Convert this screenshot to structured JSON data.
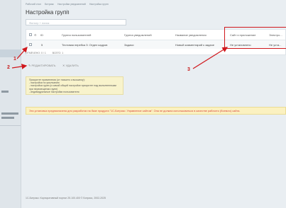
{
  "breadcrumbs": [
    "Рабочий стол",
    "Битрикс",
    "Настройки уведомлений",
    "Настройка групп"
  ],
  "page": {
    "title": "Настройка групп"
  },
  "search": {
    "placeholder": "Фильтр + поиск"
  },
  "table": {
    "headers": [
      "ID",
      "Группа пользователей",
      "Группа уведомлений",
      "Название уведомления",
      "Сайт и приложение",
      "Электро..."
    ],
    "rows": [
      {
        "id": "5",
        "user_group": "Тестовая перебка 3: Отдел кадров",
        "notify_group": "Задачи",
        "notify_name": "Новый комментарий к задаче",
        "site_app": "Не установлено",
        "email": "Не уста..."
      }
    ]
  },
  "pager": {
    "selected": "ОТМЕЧЕНО: 0 / 1",
    "total": "ВСЕГО: 1"
  },
  "actions": {
    "edit": "РЕДАКТИРОВАТЬ",
    "delete": "УДАЛИТЬ"
  },
  "hint": {
    "lines": [
      "Приоритет применения (от низшего к высшему):",
      "- настройки по умолчанию",
      "- настройки групп (и самой общей настройке приоритет над выполненными при перемещении групп)",
      "- индивидуальные настройки пользователя"
    ]
  },
  "warning": {
    "text": "Эта установка предназначена для разработки на базе продукта \"1С-Битрикс: Управление сайтом\". Она не должна использоваться в качестве рабочего (боевого) сайта."
  },
  "footer": {
    "text": "1С-Битрикс: Корпоративный портал 25.100.400 © Битрикс, 2002-2025"
  },
  "annotations": {
    "n1": "1",
    "n2": "2",
    "n3": "3"
  },
  "colors": {
    "annotation": "#d0181d",
    "warning_text": "#d9433b"
  }
}
